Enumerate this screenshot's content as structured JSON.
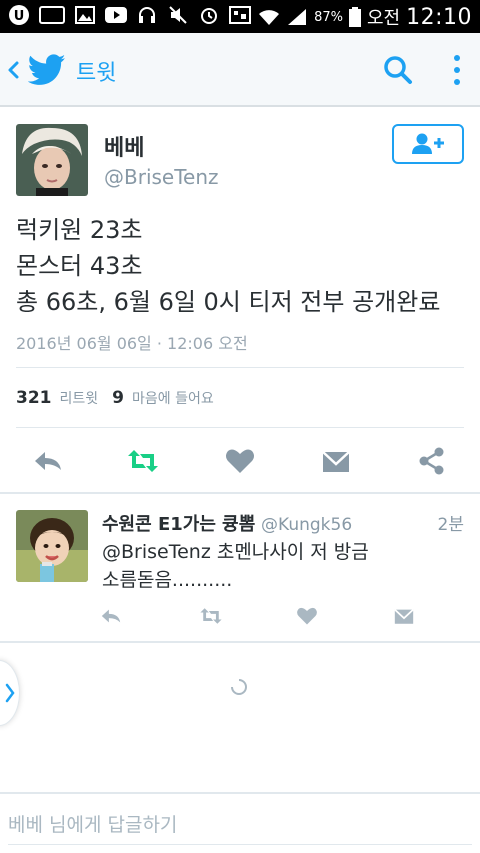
{
  "status_bar": {
    "battery_percent": "87%",
    "ampm": "오전",
    "time": "12:10",
    "icons": [
      "u-plus-icon",
      "battery-badge-icon",
      "gallery-icon",
      "youtube-icon",
      "headphones-icon",
      "mute-icon",
      "alarm-icon",
      "data-icon",
      "wifi-icon",
      "signal-icon",
      "battery-icon"
    ],
    "badge_number": "87"
  },
  "app_bar": {
    "title": "트윗",
    "accent_color": "#1da1f2"
  },
  "tweet": {
    "name": "베베",
    "handle": "@BriseTenz",
    "lines": [
      "럭키원 23초",
      "몬스터 43초",
      "총 66초, 6월 6일 0시 티저 전부 공개완료"
    ],
    "timestamp": "2016년 06월 06일 · 12:06 오전",
    "retweets": "321",
    "retweets_label": "리트윗",
    "likes": "9",
    "likes_label": "마음에 들어요"
  },
  "reply": {
    "name": "수원콘 E1가는 큥뽐",
    "handle": "@Kungk56",
    "time": "2분",
    "lines": [
      "@BriseTenz 초멘나사이 저 방금",
      "소름돋음.........."
    ]
  },
  "compose": {
    "placeholder": "베베 님에게 답글하기"
  },
  "colors": {
    "retweet_green": "#19cf86",
    "icon_gray": "#8899a6",
    "text": "#292f33"
  }
}
